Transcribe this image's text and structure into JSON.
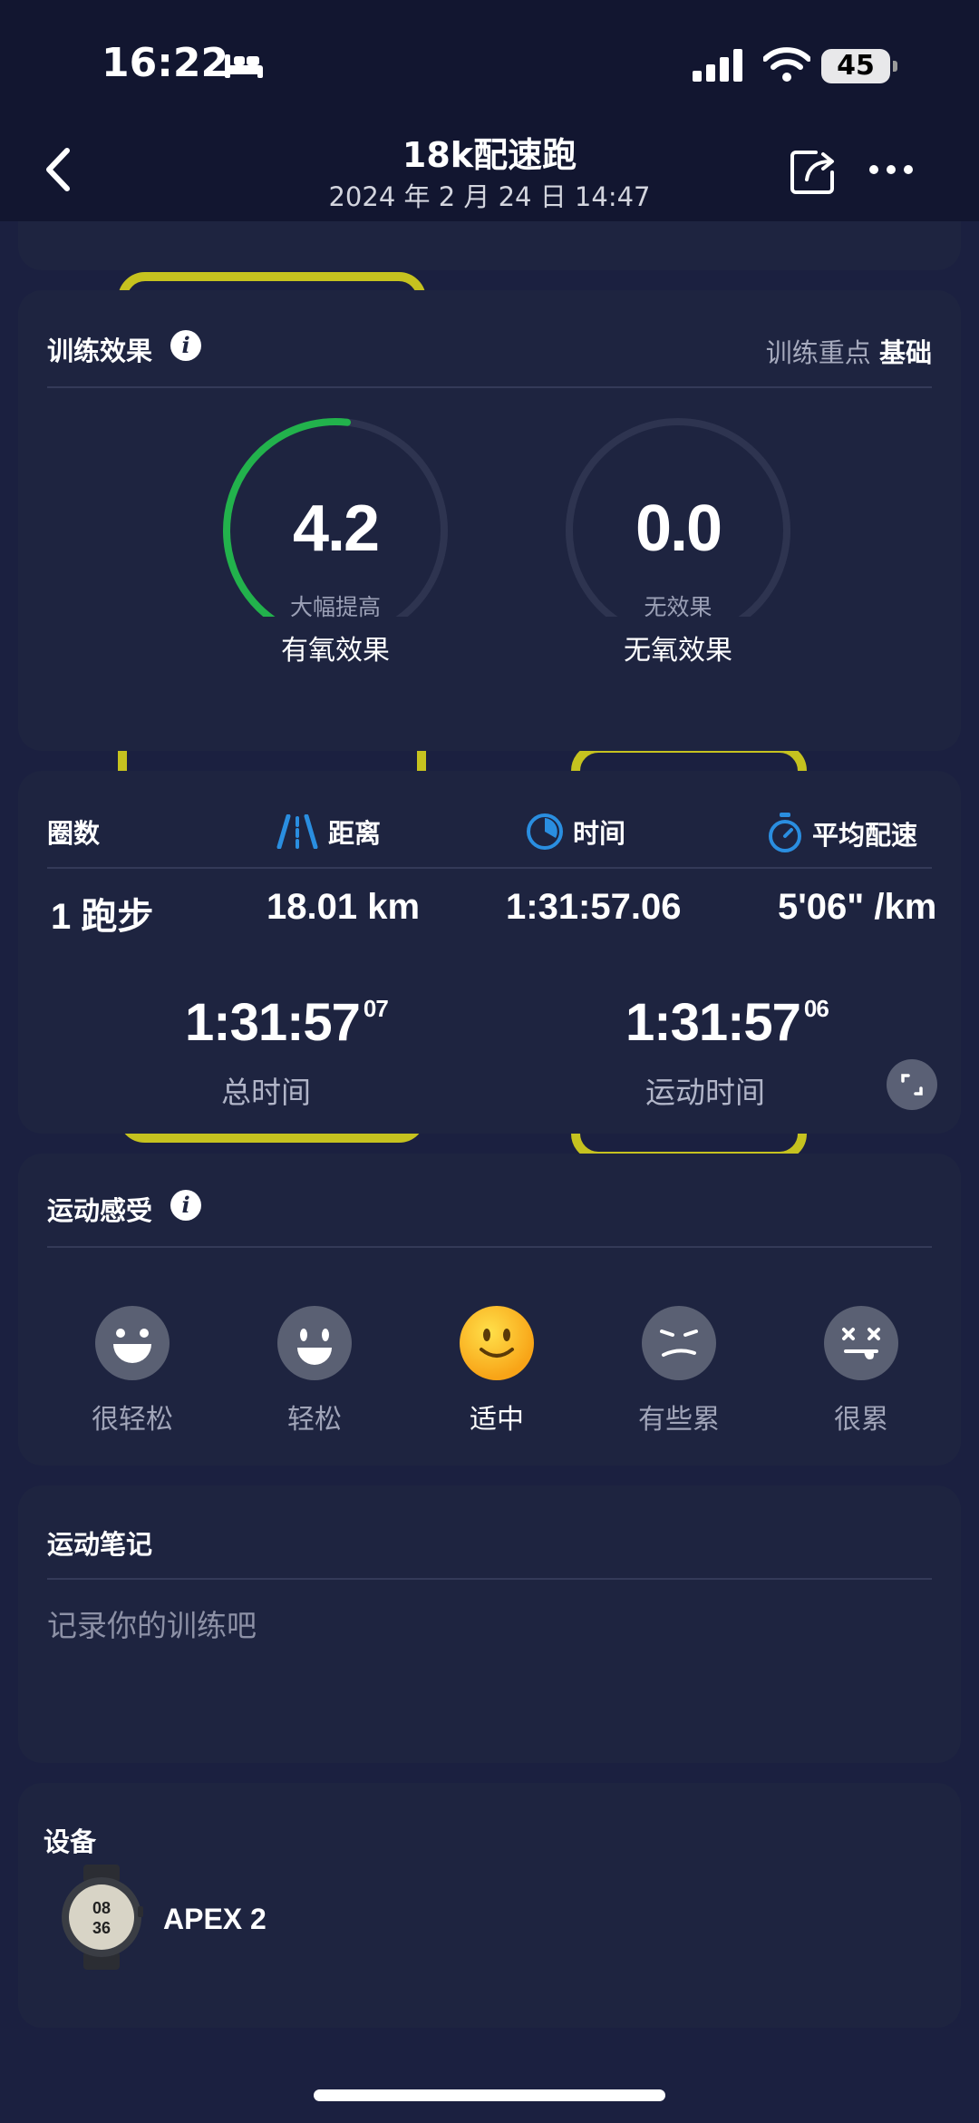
{
  "status_bar": {
    "time": "16:22",
    "battery": "45",
    "icons": [
      "bed-icon",
      "signal-icon",
      "wifi-icon",
      "battery-icon"
    ]
  },
  "header": {
    "title": "18k配速跑",
    "subtitle": "2024 年 2 月 24 日 14:47",
    "icons": [
      "back-icon",
      "share-icon",
      "more-icon"
    ]
  },
  "training_effect": {
    "title": "训练效果",
    "focus_label": "训练重点",
    "focus_value": "基础",
    "aerobic": {
      "value": "4.2",
      "sub": "大幅提高",
      "name": "有氧效果",
      "fraction": 0.84
    },
    "anaerobic": {
      "value": "0.0",
      "sub": "无效果",
      "name": "无氧效果",
      "fraction": 0.0
    },
    "colors": {
      "gauge_fill": "#22b24c",
      "gauge_track": "#2e3450"
    }
  },
  "laps": {
    "headers": {
      "laps": "圈数",
      "distance": "距离",
      "time": "时间",
      "pace": "平均配速"
    },
    "row": {
      "laps": "1 跑步",
      "distance": "18.01 km",
      "time": "1:31:57.06",
      "pace": "5'06\" /km"
    },
    "total_time": {
      "main": "1:31:57",
      "sup": "07",
      "label": "总时间"
    },
    "moving_time": {
      "main": "1:31:57",
      "sup": "06",
      "label": "运动时间"
    },
    "accent_color": "#2a8ee0"
  },
  "feeling": {
    "title": "运动感受",
    "options": [
      {
        "label": "很轻松",
        "icon": "laughing-face-icon"
      },
      {
        "label": "轻松",
        "icon": "smiling-face-icon"
      },
      {
        "label": "适中",
        "icon": "slight-smile-face-icon"
      },
      {
        "label": "有些累",
        "icon": "tired-face-icon"
      },
      {
        "label": "很累",
        "icon": "exhausted-face-icon"
      }
    ],
    "selected": "适中"
  },
  "notes": {
    "title": "运动笔记",
    "placeholder": "记录你的训练吧"
  },
  "device": {
    "title": "设备",
    "name": "APEX 2",
    "watch_face": {
      "line1": "08",
      "line2": "36"
    }
  }
}
